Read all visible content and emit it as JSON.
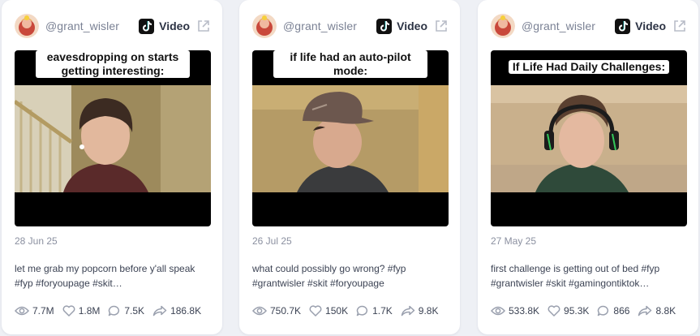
{
  "cards": [
    {
      "username": "@grant_wisler",
      "platform": "Video",
      "overlay_text": "eavesdropping on starts getting interesting:",
      "date": "28 Jun 25",
      "description": "let me grab my popcorn before y'all speak #fyp #foryoupage #skit…",
      "stats": {
        "views": "7.7M",
        "likes": "1.8M",
        "comments": "7.5K",
        "shares": "186.8K"
      }
    },
    {
      "username": "@grant_wisler",
      "platform": "Video",
      "overlay_text": "if life had an auto-pilot mode:",
      "date": "26 Jul 25",
      "description": "what could possibly go wrong? #fyp #grantwisler #skit #foryoupage",
      "stats": {
        "views": "750.7K",
        "likes": "150K",
        "comments": "1.7K",
        "shares": "9.8K"
      }
    },
    {
      "username": "@grant_wisler",
      "platform": "Video",
      "overlay_text": "If Life Had Daily Challenges:",
      "date": "27 May 25",
      "description": "first challenge is getting out of bed #fyp #grantwisler #skit #gamingontiktok…",
      "stats": {
        "views": "533.8K",
        "likes": "95.3K",
        "comments": "866",
        "shares": "8.8K"
      }
    }
  ],
  "colors": {
    "background": "#eef0f5",
    "card": "#ffffff",
    "muted_text": "#8b90a0",
    "body_text": "#3c4354",
    "icon": "#9aa0ae"
  },
  "icons": {
    "platform": "tiktok-icon",
    "open": "external-link-icon",
    "views": "eye-icon",
    "likes": "heart-icon",
    "comments": "comment-icon",
    "shares": "share-icon"
  }
}
